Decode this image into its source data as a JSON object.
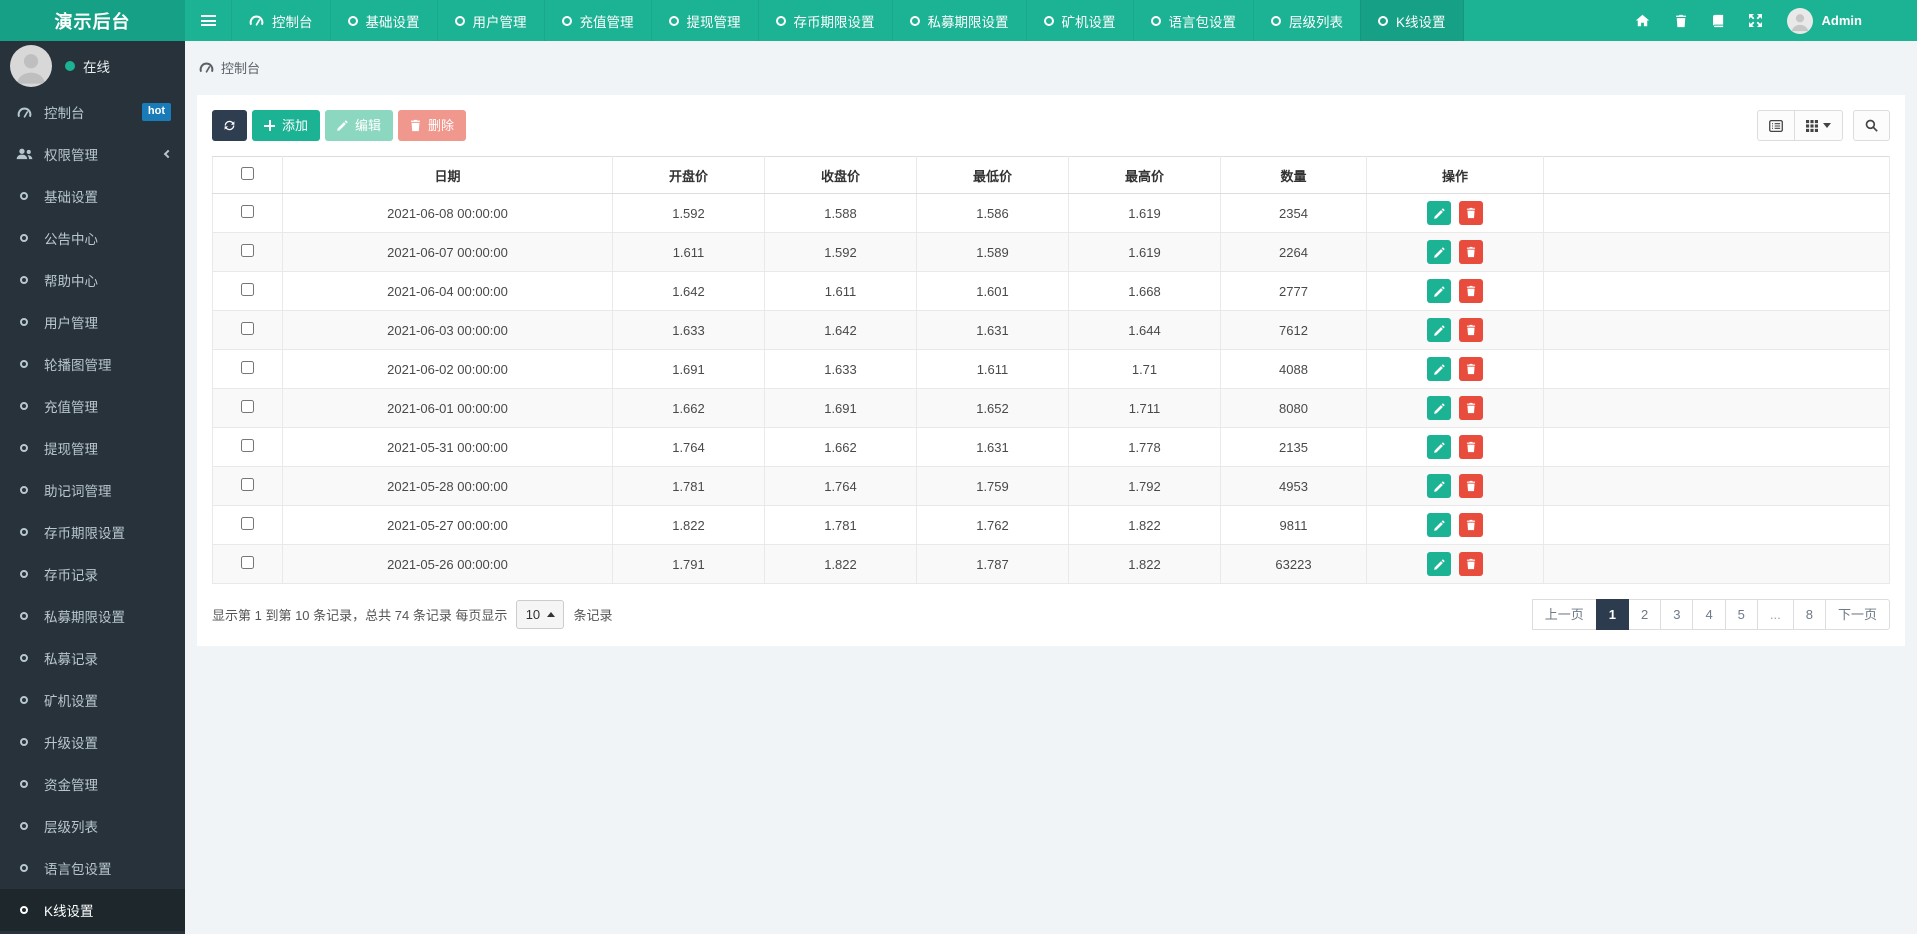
{
  "navbar": {
    "brand": "演示后台",
    "items": [
      {
        "label": "控制台",
        "icon": "tachometer"
      },
      {
        "label": "基础设置",
        "icon": "circle"
      },
      {
        "label": "用户管理",
        "icon": "circle"
      },
      {
        "label": "充值管理",
        "icon": "circle"
      },
      {
        "label": "提现管理",
        "icon": "circle"
      },
      {
        "label": "存币期限设置",
        "icon": "circle"
      },
      {
        "label": "私募期限设置",
        "icon": "circle"
      },
      {
        "label": "矿机设置",
        "icon": "circle"
      },
      {
        "label": "语言包设置",
        "icon": "circle"
      },
      {
        "label": "层级列表",
        "icon": "circle"
      },
      {
        "label": "K线设置",
        "icon": "circle",
        "active": true
      }
    ],
    "right_icons": [
      "home-icon",
      "trash-icon",
      "book-icon",
      "fullscreen-icon"
    ],
    "user": "Admin"
  },
  "sidebar": {
    "status": "在线",
    "items": [
      {
        "label": "控制台",
        "icon": "tachometer",
        "badge": "hot"
      },
      {
        "label": "权限管理",
        "icon": "users",
        "collapsible": true
      },
      {
        "label": "基础设置",
        "icon": "circle"
      },
      {
        "label": "公告中心",
        "icon": "circle"
      },
      {
        "label": "帮助中心",
        "icon": "circle"
      },
      {
        "label": "用户管理",
        "icon": "circle"
      },
      {
        "label": "轮播图管理",
        "icon": "circle"
      },
      {
        "label": "充值管理",
        "icon": "circle"
      },
      {
        "label": "提现管理",
        "icon": "circle"
      },
      {
        "label": "助记词管理",
        "icon": "circle"
      },
      {
        "label": "存币期限设置",
        "icon": "circle"
      },
      {
        "label": "存币记录",
        "icon": "circle"
      },
      {
        "label": "私募期限设置",
        "icon": "circle"
      },
      {
        "label": "私募记录",
        "icon": "circle"
      },
      {
        "label": "矿机设置",
        "icon": "circle"
      },
      {
        "label": "升级设置",
        "icon": "circle"
      },
      {
        "label": "资金管理",
        "icon": "circle"
      },
      {
        "label": "层级列表",
        "icon": "circle"
      },
      {
        "label": "语言包设置",
        "icon": "circle"
      },
      {
        "label": "K线设置",
        "icon": "circle",
        "active": true
      }
    ]
  },
  "breadcrumb": {
    "label": "控制台"
  },
  "toolbar": {
    "add": "添加",
    "edit": "编辑",
    "delete": "删除"
  },
  "table": {
    "columns": [
      "日期",
      "开盘价",
      "收盘价",
      "最低价",
      "最高价",
      "数量",
      "操作"
    ],
    "rows": [
      {
        "date": "2021-06-08 00:00:00",
        "open": "1.592",
        "close": "1.588",
        "low": "1.586",
        "high": "1.619",
        "qty": "2354"
      },
      {
        "date": "2021-06-07 00:00:00",
        "open": "1.611",
        "close": "1.592",
        "low": "1.589",
        "high": "1.619",
        "qty": "2264"
      },
      {
        "date": "2021-06-04 00:00:00",
        "open": "1.642",
        "close": "1.611",
        "low": "1.601",
        "high": "1.668",
        "qty": "2777"
      },
      {
        "date": "2021-06-03 00:00:00",
        "open": "1.633",
        "close": "1.642",
        "low": "1.631",
        "high": "1.644",
        "qty": "7612"
      },
      {
        "date": "2021-06-02 00:00:00",
        "open": "1.691",
        "close": "1.633",
        "low": "1.611",
        "high": "1.71",
        "qty": "4088"
      },
      {
        "date": "2021-06-01 00:00:00",
        "open": "1.662",
        "close": "1.691",
        "low": "1.652",
        "high": "1.711",
        "qty": "8080"
      },
      {
        "date": "2021-05-31 00:00:00",
        "open": "1.764",
        "close": "1.662",
        "low": "1.631",
        "high": "1.778",
        "qty": "2135"
      },
      {
        "date": "2021-05-28 00:00:00",
        "open": "1.781",
        "close": "1.764",
        "low": "1.759",
        "high": "1.792",
        "qty": "4953"
      },
      {
        "date": "2021-05-27 00:00:00",
        "open": "1.822",
        "close": "1.781",
        "low": "1.762",
        "high": "1.822",
        "qty": "9811"
      },
      {
        "date": "2021-05-26 00:00:00",
        "open": "1.791",
        "close": "1.822",
        "low": "1.787",
        "high": "1.822",
        "qty": "63223"
      }
    ]
  },
  "pagination": {
    "info_prefix": "显示第 1 到第 10 条记录，总共 74 条记录 每页显示",
    "page_size": "10",
    "info_suffix": "条记录",
    "pages": [
      {
        "label": "上一页",
        "cls": "page-prev"
      },
      {
        "label": "1",
        "cls": "active"
      },
      {
        "label": "2"
      },
      {
        "label": "3"
      },
      {
        "label": "4"
      },
      {
        "label": "5"
      },
      {
        "label": "...",
        "cls": "ellipsis"
      },
      {
        "label": "8"
      },
      {
        "label": "下一页",
        "cls": "page-next"
      }
    ]
  },
  "colors": {
    "brand_teal": "#1cb294",
    "brand_teal_dark": "#16a085",
    "sidebar_bg": "#28323a",
    "sidebar_active_bg": "#1e282c",
    "badge_blue": "#1a7bb9",
    "button_dark": "#2e3d4f",
    "danger_red": "#e74c3c",
    "pagination_active": "#2c3b4e"
  }
}
